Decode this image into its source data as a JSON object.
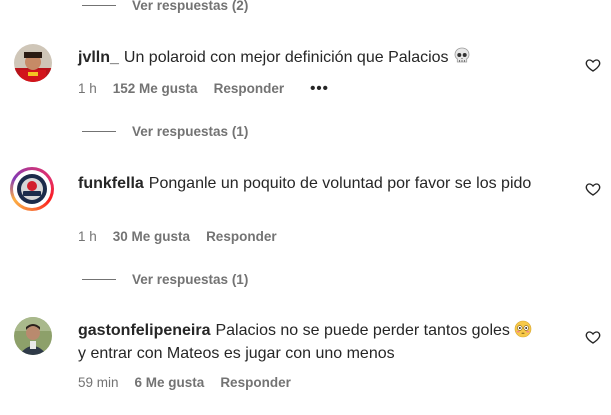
{
  "thread0": {
    "view_replies": "Ver respuestas (2)"
  },
  "comments": [
    {
      "username": "jvlln_",
      "text": "Un polaroid con mejor definición que Palacios",
      "emoji": "skull-emoji",
      "time": "1 h",
      "likes": "152 Me gusta",
      "reply": "Responder",
      "more": "•••",
      "view_replies": "Ver respuestas (1)"
    },
    {
      "username": "funkfella",
      "text": "Ponganle un poquito de voluntad por favor se los pido",
      "time": "1 h",
      "likes": "30 Me gusta",
      "reply": "Responder",
      "view_replies": "Ver respuestas (1)"
    },
    {
      "username": "gastonfelipeneira",
      "text": "Palacios no se puede perder tantos goles",
      "emoji": "flushed-face-emoji",
      "text2": "y entrar con Mateos es jugar con uno menos",
      "time": "59 min",
      "likes": "6 Me gusta",
      "reply": "Responder"
    }
  ],
  "icons": {
    "like": "heart-outline-icon"
  },
  "colors": {
    "text": "#262626",
    "secondary": "#737373",
    "background": "#ffffff"
  }
}
